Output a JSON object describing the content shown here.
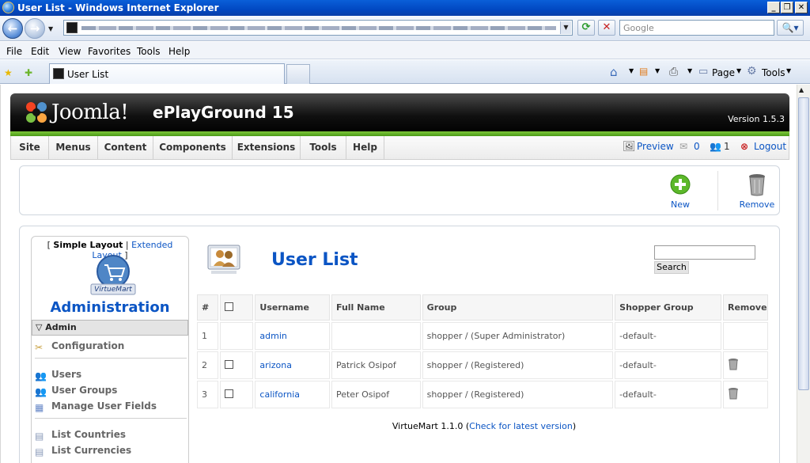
{
  "window": {
    "title": "User List - Windows Internet Explorer"
  },
  "browser": {
    "search_placeholder": "Google",
    "menu": [
      "File",
      "Edit",
      "View",
      "Favorites",
      "Tools",
      "Help"
    ],
    "tab_title": "User List",
    "commands": {
      "page": "Page",
      "tools": "Tools"
    }
  },
  "joomla": {
    "logo_text": "Joomla!",
    "site_name": "ePlayGround 15",
    "version": "Version 1.5.3",
    "menu": [
      "Site",
      "Menus",
      "Content",
      "Components",
      "Extensions",
      "Tools",
      "Help"
    ],
    "preview": "Preview",
    "messages_count": "0",
    "users_count": "1",
    "logout": "Logout"
  },
  "toolbar": {
    "new_label": "New",
    "remove_label": "Remove"
  },
  "sidebar": {
    "bracket_open": "[",
    "simple_layout": "Simple Layout",
    "divider": "|",
    "extended_layout": "Extended Layout",
    "bracket_close": "]",
    "vm_logo_text": "VirtueMart",
    "title": "Administration",
    "section": "Admin",
    "items": [
      {
        "label": "Configuration"
      },
      {
        "label": "Users"
      },
      {
        "label": "User Groups"
      },
      {
        "label": "Manage User Fields"
      },
      {
        "label": "List Countries"
      },
      {
        "label": "List Currencies"
      }
    ]
  },
  "main": {
    "title": "User List",
    "search_button": "Search",
    "columns": [
      "#",
      "",
      "Username",
      "Full Name",
      "Group",
      "Shopper Group",
      "Remove"
    ],
    "rows": [
      {
        "num": "1",
        "username": "admin",
        "fullname": "",
        "group": "shopper / (Super Administrator)",
        "shopper_group": "-default-"
      },
      {
        "num": "2",
        "username": "arizona",
        "fullname": "Patrick Osipof",
        "group": "shopper / (Registered)",
        "shopper_group": "-default-"
      },
      {
        "num": "3",
        "username": "california",
        "fullname": "Peter Osipof",
        "group": "shopper / (Registered)",
        "shopper_group": "-default-"
      }
    ],
    "footer_prefix": "VirtueMart 1.1.0 (",
    "footer_link": "Check for latest version",
    "footer_suffix": ")"
  },
  "colors": {
    "link_blue": "#0b55c4",
    "joomla_green": "#6cb52c",
    "ie_title_blue": "#0148c2"
  }
}
